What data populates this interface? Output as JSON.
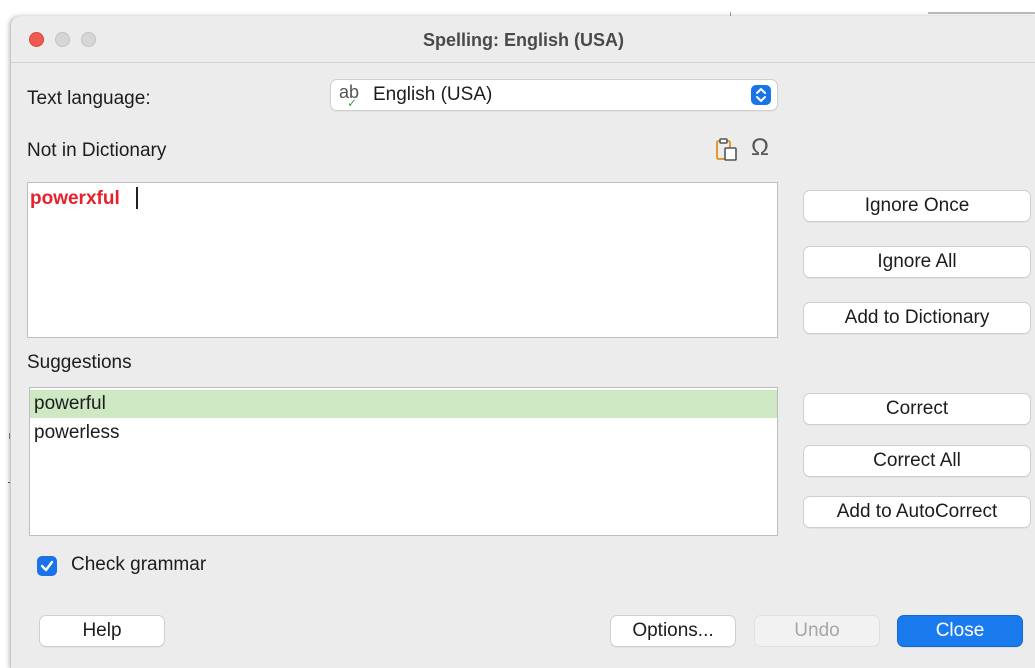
{
  "window": {
    "title": "Spelling: English (USA)"
  },
  "language": {
    "label": "Text language:",
    "icon": "spellcheck-ab-icon",
    "selected": "English (USA)"
  },
  "not_in_dictionary": {
    "label": "Not in Dictionary",
    "word": "powerxful",
    "word_color": "#e8202a",
    "icons": [
      "paste-icon",
      "omega-special-character-icon"
    ]
  },
  "suggestions": {
    "label": "Suggestions",
    "items": [
      {
        "text": "powerful",
        "selected": true
      },
      {
        "text": "powerless",
        "selected": false
      }
    ],
    "selected_color": "#cfe8c4"
  },
  "buttons": {
    "ignore_once": "Ignore Once",
    "ignore_all": "Ignore All",
    "add_to_dictionary": "Add to Dictionary",
    "correct": "Correct",
    "correct_all": "Correct All",
    "add_to_autocorrect": "Add to AutoCorrect",
    "help": "Help",
    "options": "Options...",
    "undo": "Undo",
    "close": "Close"
  },
  "check_grammar": {
    "label": "Check grammar",
    "checked": true
  },
  "colors": {
    "accent": "#1a73e8",
    "primary_button": "#1a7bef"
  }
}
